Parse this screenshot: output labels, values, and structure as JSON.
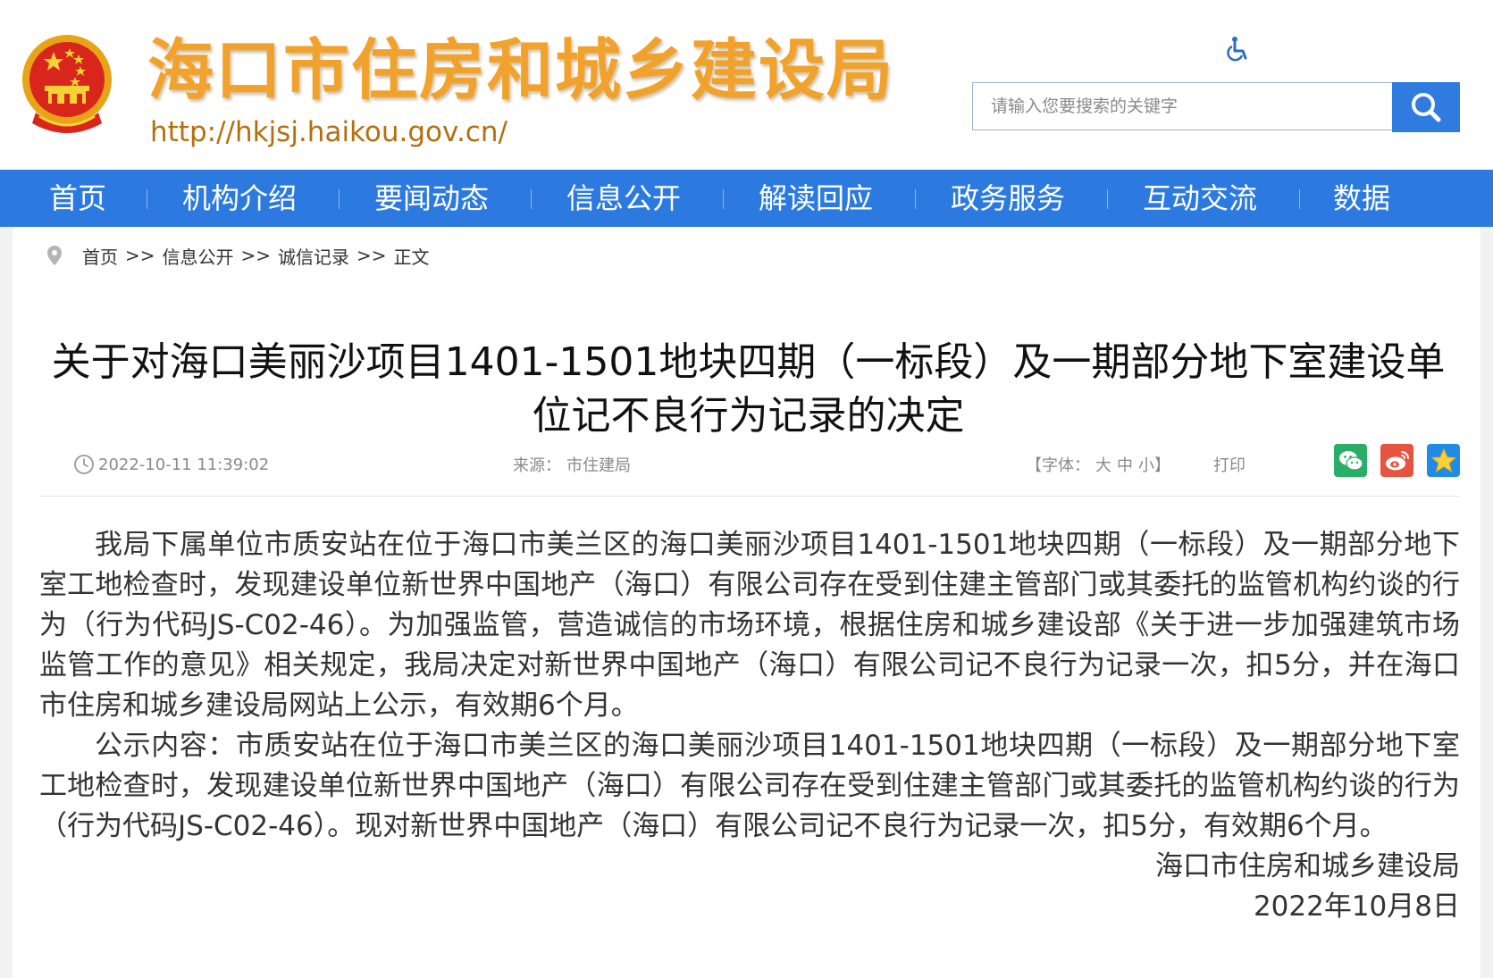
{
  "header": {
    "site_title": "海口市住房和城乡建设局",
    "site_url": "http://hkjsj.haikou.gov.cn/",
    "search_placeholder": "请输入您要搜索的关键字"
  },
  "nav": {
    "items": [
      {
        "label": "首页"
      },
      {
        "label": "机构介绍"
      },
      {
        "label": "要闻动态"
      },
      {
        "label": "信息公开"
      },
      {
        "label": "解读回应"
      },
      {
        "label": "政务服务"
      },
      {
        "label": "互动交流"
      },
      {
        "label": "数据"
      }
    ]
  },
  "breadcrumb": {
    "items": [
      "首页",
      "信息公开",
      "诚信记录",
      "正文"
    ],
    "separator": ">>"
  },
  "article": {
    "title": "关于对海口美丽沙项目1401-1501地块四期（一标段）及一期部分地下室建设单位记不良行为记录的决定",
    "datetime": "2022-10-11 11:39:02",
    "source_label": "来源：",
    "source": "市住建局",
    "font_label": "【字体：",
    "font_large": "大",
    "font_medium": "中",
    "font_small": "小】",
    "print_label": "打印",
    "paragraphs": [
      "我局下属单位市质安站在位于海口市美兰区的海口美丽沙项目1401-1501地块四期（一标段）及一期部分地下室工地检查时，发现建设单位新世界中国地产（海口）有限公司存在受到住建主管部门或其委托的监管机构约谈的行为（行为代码JS-C02-46）。为加强监管，营造诚信的市场环境，根据住房和城乡建设部《关于进一步加强建筑市场监管工作的意见》相关规定，我局决定对新世界中国地产（海口）有限公司记不良行为记录一次，扣5分，并在海口市住房和城乡建设局网站上公示，有效期6个月。",
      "公示内容：市质安站在位于海口市美兰区的海口美丽沙项目1401-1501地块四期（一标段）及一期部分地下室工地检查时，发现建设单位新世界中国地产（海口）有限公司存在受到住建主管部门或其委托的监管机构约谈的行为（行为代码JS-C02-46）。现对新世界中国地产（海口）有限公司记不良行为记录一次，扣5分，有效期6个月。"
    ],
    "signature": "海口市住房和城乡建设局",
    "sign_date": "2022年10月8日"
  },
  "colors": {
    "nav_bg": "#2c7ae0",
    "title_orange": "#f0a22c",
    "url_brown": "#b46f11",
    "wechat_green": "#2aae67",
    "weibo_red": "#e6533f",
    "favorite_blue": "#1f8be6"
  },
  "icons": {
    "accessibility": "wheelchair-icon",
    "search": "magnifier-icon",
    "location": "map-pin-icon",
    "time": "clock-icon",
    "share": [
      "wechat-icon",
      "weibo-icon",
      "star-icon"
    ]
  }
}
